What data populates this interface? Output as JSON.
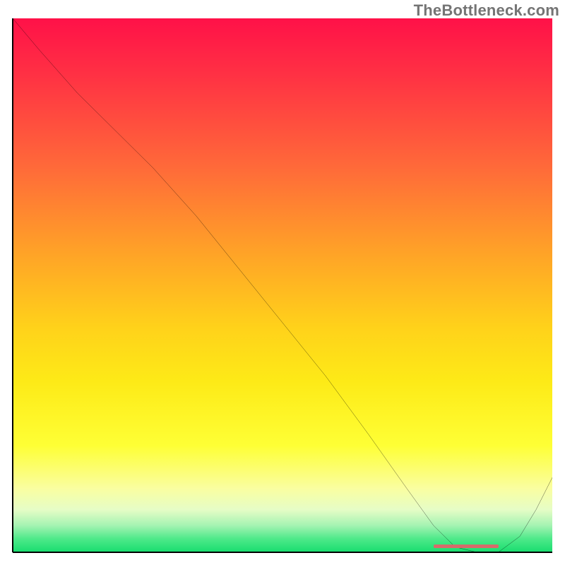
{
  "watermark": {
    "text": "TheBottleneck.com"
  },
  "colors": {
    "curve": "#000000",
    "marker": "#d66b6b",
    "axis": "#000000"
  },
  "chart_data": {
    "type": "line",
    "title": "",
    "xlabel": "",
    "ylabel": "",
    "xlim": [
      0,
      100
    ],
    "ylim": [
      0,
      100
    ],
    "legend": false,
    "grid": false,
    "series": [
      {
        "name": "bottleneck-curve",
        "x": [
          0,
          5,
          12,
          20,
          26,
          34,
          42,
          50,
          58,
          66,
          73,
          78,
          82,
          86,
          90,
          94,
          97,
          100
        ],
        "y": [
          100,
          94,
          86,
          78,
          72,
          63,
          53,
          43,
          33,
          22,
          12,
          5,
          1,
          0,
          0,
          3,
          8,
          14
        ]
      }
    ],
    "annotations": [
      {
        "name": "optimal-zone-marker",
        "x_start": 78,
        "x_end": 90,
        "y": 0.8
      }
    ]
  }
}
